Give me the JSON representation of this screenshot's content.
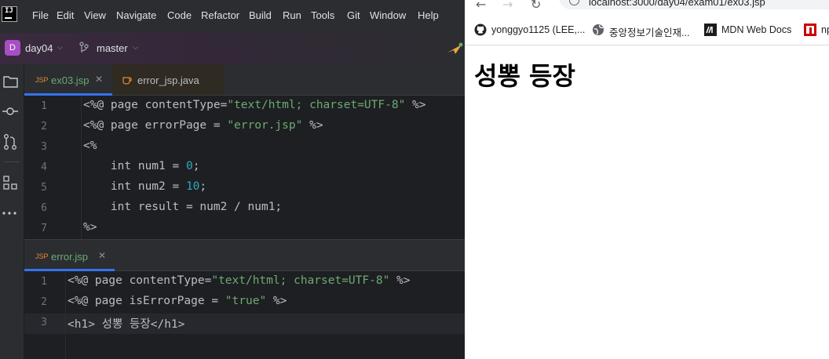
{
  "ide": {
    "menu": [
      "File",
      "Edit",
      "View",
      "Navigate",
      "Code",
      "Refactor",
      "Build",
      "Run",
      "Tools",
      "Git",
      "Window",
      "Help"
    ],
    "project": {
      "badge": "D",
      "name": "day04",
      "branch": "master"
    },
    "top_pane": {
      "tabs": [
        {
          "type_label": "JSP",
          "label": "ex03.jsp",
          "active": true,
          "closable": true,
          "color": "#6aab73"
        },
        {
          "type_label": "",
          "label": "error_jsp.java",
          "active": false,
          "closable": false,
          "color": "#bcbec4"
        }
      ],
      "line_numbers": [
        "1",
        "2",
        "3",
        "4",
        "5",
        "6",
        "7"
      ],
      "lines": [
        [
          [
            "plain",
            "<%@ page contentType="
          ],
          [
            "str",
            "\"text/html; charset=UTF-8\""
          ],
          [
            "plain",
            " %>"
          ]
        ],
        [
          [
            "plain",
            "<%@ page errorPage = "
          ],
          [
            "str",
            "\"error.jsp\""
          ],
          [
            "plain",
            " %>"
          ]
        ],
        [
          [
            "plain",
            "<%"
          ]
        ],
        [
          [
            "plain",
            "    int num1 = "
          ],
          [
            "num",
            "0"
          ],
          [
            "plain",
            ";"
          ]
        ],
        [
          [
            "plain",
            "    int num2 = "
          ],
          [
            "num",
            "10"
          ],
          [
            "plain",
            ";"
          ]
        ],
        [
          [
            "plain",
            "    int result = num2 / num1;"
          ]
        ],
        [
          [
            "plain",
            "%>"
          ]
        ]
      ]
    },
    "bottom_pane": {
      "tabs": [
        {
          "type_label": "JSP",
          "label": "error.jsp",
          "active": true,
          "closable": true,
          "color": "#6aab73"
        }
      ],
      "line_numbers": [
        "1",
        "2",
        "3"
      ],
      "lines": [
        [
          [
            "plain",
            "<%@ page contentType="
          ],
          [
            "str",
            "\"text/html; charset=UTF-8\""
          ],
          [
            "plain",
            " %>"
          ]
        ],
        [
          [
            "plain",
            "<%@ page isErrorPage = "
          ],
          [
            "str",
            "\"true\""
          ],
          [
            "plain",
            " %>"
          ]
        ],
        [
          [
            "plain",
            "<h1> 성뽕 등장</h1>"
          ]
        ]
      ]
    },
    "colors": {
      "accent": "#3574f0",
      "string": "#6aab73",
      "number": "#2aacb8",
      "project_badge": "#a84ec6"
    }
  },
  "browser": {
    "url": "localhost:3000/day04/exam01/ex03.jsp",
    "bookmarks": [
      {
        "icon": "github-icon",
        "label": "yonggyo1125 (LEE,..."
      },
      {
        "icon": "globe-icon",
        "label": "중앙정보기술인재..."
      },
      {
        "icon": "mdn-icon",
        "label": "MDN Web Docs"
      },
      {
        "icon": "npm-icon",
        "label": "np"
      }
    ],
    "page": {
      "heading": "성뽕 등장"
    }
  }
}
